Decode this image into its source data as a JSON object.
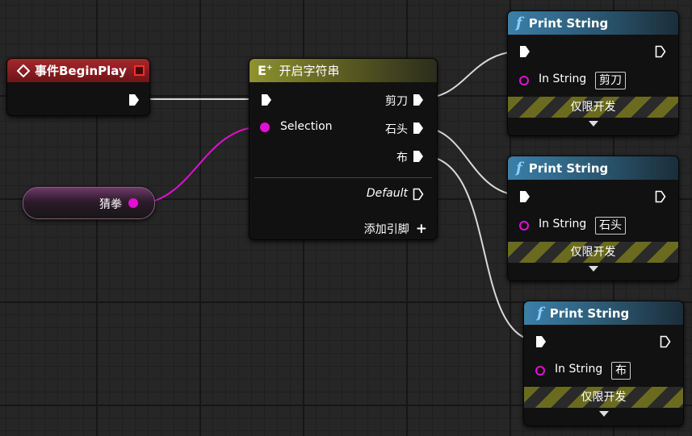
{
  "event_node": {
    "title": "事件BeginPlay",
    "accent": "#a5282c"
  },
  "variable_node": {
    "label": "猜拳",
    "pin_color": "#e110d4"
  },
  "switch_node": {
    "title": "开启字符串",
    "selection_label": "Selection",
    "outputs": [
      "剪刀",
      "石头",
      "布"
    ],
    "default_label": "Default",
    "add_pin_label": "添加引脚",
    "add_pin_icon": "plus-icon"
  },
  "print_nodes": [
    {
      "title": "Print String",
      "in_label": "In String",
      "value": "剪刀",
      "dev_label": "仅限开发"
    },
    {
      "title": "Print String",
      "in_label": "In String",
      "value": "石头",
      "dev_label": "仅限开发"
    },
    {
      "title": "Print String",
      "in_label": "In String",
      "value": "布",
      "dev_label": "仅限开发"
    }
  ],
  "colors": {
    "string_pin": "#e110d4",
    "exec_wire": "#d9d9d9",
    "background": "#262626"
  }
}
